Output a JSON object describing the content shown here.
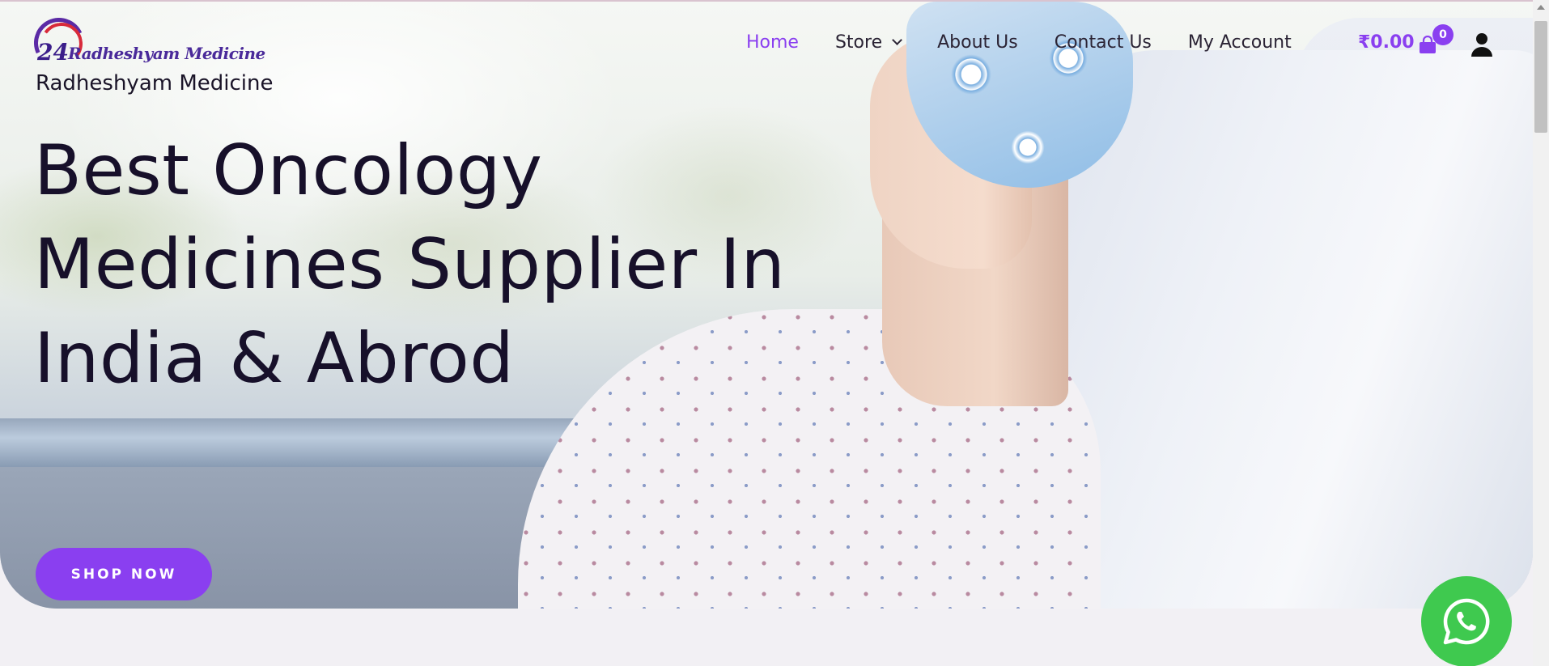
{
  "brand": {
    "logo_number": "24",
    "logo_script": "Radheshyam Medicine",
    "site_title": "Radheshyam Medicine"
  },
  "nav": {
    "items": [
      {
        "label": "Home",
        "active": true
      },
      {
        "label": "Store",
        "has_dropdown": true
      },
      {
        "label": "About Us"
      },
      {
        "label": "Contact Us"
      },
      {
        "label": "My Account"
      }
    ]
  },
  "cart": {
    "total": "₹0.00",
    "count": "0"
  },
  "hero": {
    "headline": "Best Oncology Medicines Supplier In India & Abrod",
    "cta_label": "SHOP NOW"
  },
  "colors": {
    "accent": "#8a3ff0",
    "whatsapp": "#3fc94f",
    "text_dark": "#17102a"
  },
  "icons": [
    "cart-icon",
    "user-icon",
    "whatsapp-icon",
    "chevron-down-icon"
  ]
}
